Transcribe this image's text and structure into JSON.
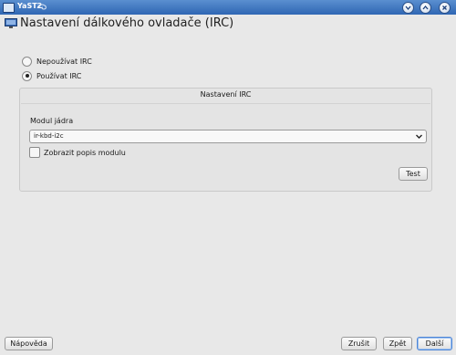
{
  "window": {
    "title": "YaST2"
  },
  "heading": {
    "title": "Nastavení dálkového ovladače (IRC)"
  },
  "options": [
    {
      "label": "Nepoužívat IRC",
      "checked": false
    },
    {
      "label": "Používat IRC",
      "checked": true
    }
  ],
  "panel": {
    "title": "Nastavení IRC",
    "module_label": "Modul jádra",
    "module_value": "ir-kbd-i2c",
    "show_description_label": "Zobrazit popis modulu",
    "test_label": "Test"
  },
  "footer": {
    "help_label": "Nápověda",
    "cancel_label": "Zrušit",
    "back_label": "Zpět",
    "next_label": "Další"
  },
  "colors": {
    "titlebar": "#2f66b3",
    "default_button_border": "#4e86d6"
  }
}
